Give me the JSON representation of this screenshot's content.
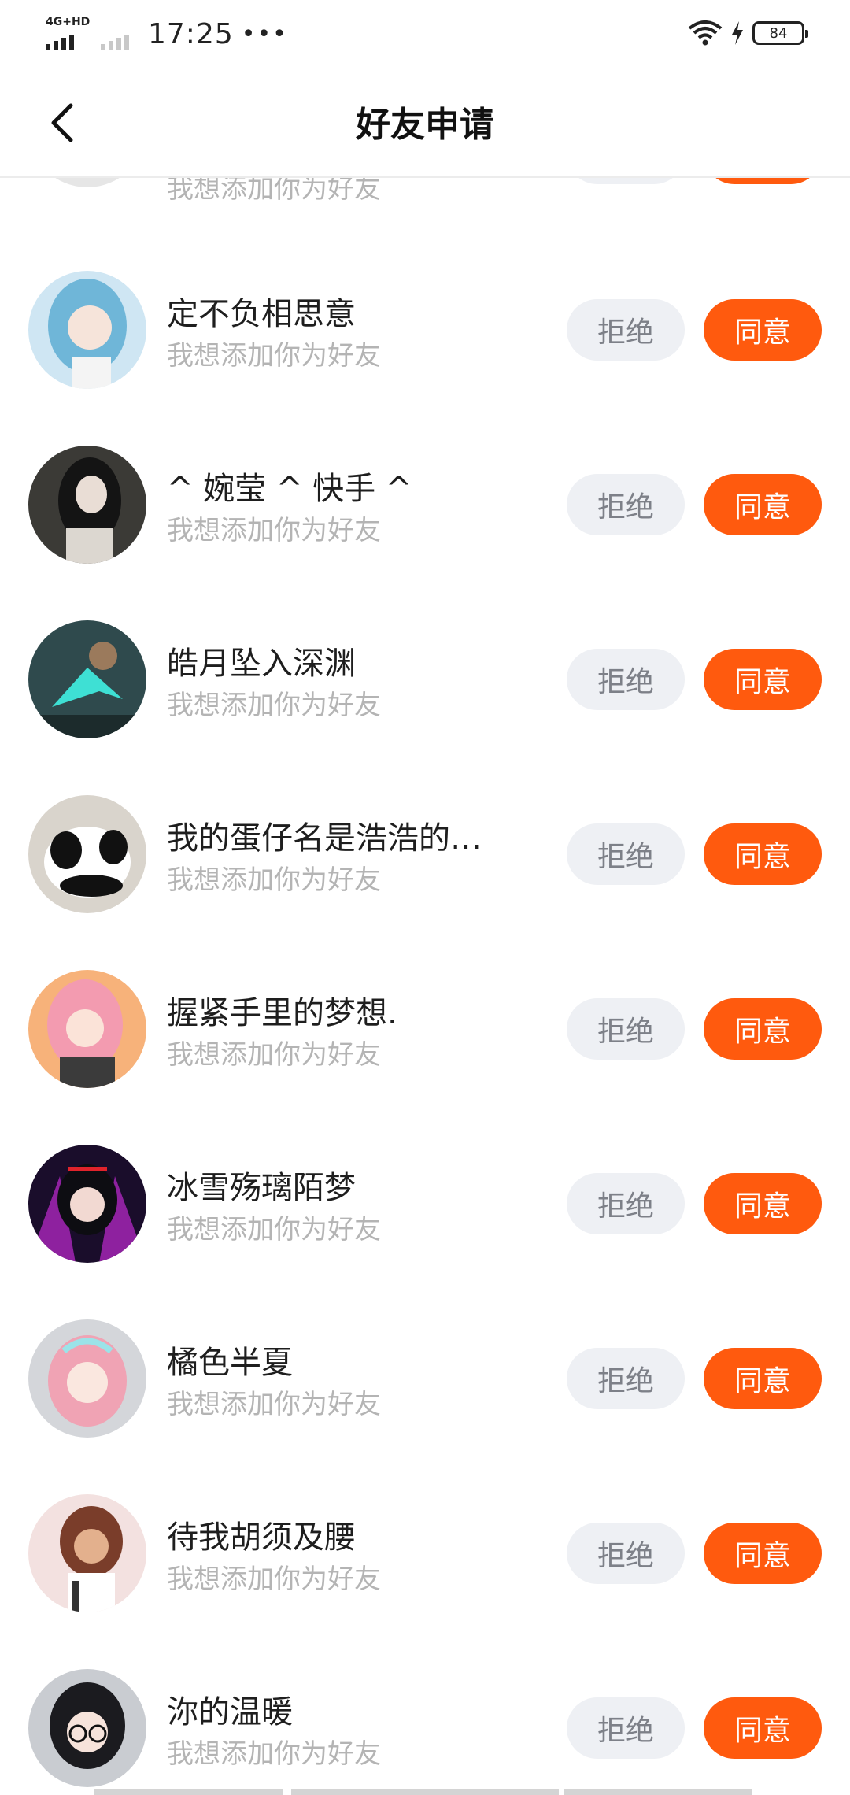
{
  "status_bar": {
    "network": "4G+HD",
    "time": "17:25",
    "more": "•••",
    "battery": "84"
  },
  "nav": {
    "title": "好友申请"
  },
  "request_subtitle": "我想添加你为好友",
  "reject_label": "拒绝",
  "accept_label": "同意",
  "requests": [
    {
      "name": ""
    },
    {
      "name": "定不负相思意"
    },
    {
      "name": "^ 婉莹 ^ 快手 ^"
    },
    {
      "name": "皓月坠入深渊"
    },
    {
      "name": "我的蛋仔名是浩浩的…"
    },
    {
      "name": "握紧手里的梦想."
    },
    {
      "name": "冰雪殇璃陌梦"
    },
    {
      "name": "橘色半夏"
    },
    {
      "name": "待我胡须及腰"
    },
    {
      "name": "沵的温暖"
    }
  ],
  "colors": {
    "accent": "#ff5a0e",
    "reject_bg": "#eef0f4",
    "subtitle": "#b4b4b4"
  }
}
